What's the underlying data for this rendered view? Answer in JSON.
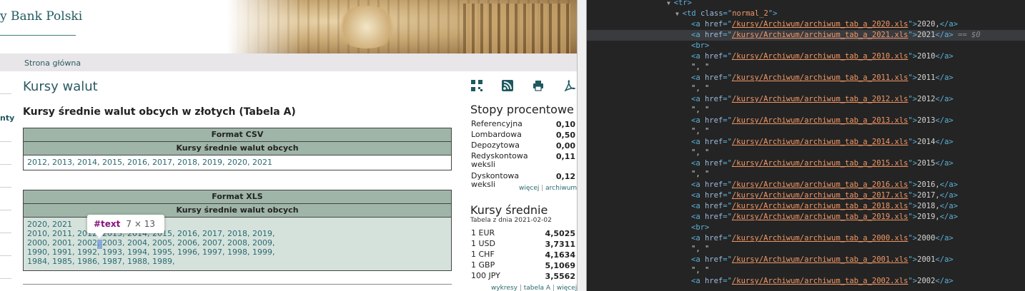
{
  "bank_title": "y Bank Polski",
  "nav": {
    "home": "Strona główna"
  },
  "sidebar_label": "nty",
  "page_heading": "Kursy walut",
  "section_title": "Kursy średnie walut obcych w złotych (Tabela A)",
  "csv_table": {
    "format": "Format CSV",
    "subheader": "Kursy średnie walut obcych",
    "years": [
      "2012",
      "2013",
      "2014",
      "2015",
      "2016",
      "2017",
      "2018",
      "2019",
      "2020",
      "2021"
    ]
  },
  "xls_table": {
    "format": "Format XLS",
    "subheader": "Kursy średnie walut obcych",
    "lines": [
      [
        "2020",
        "2021"
      ],
      [
        "2010",
        "2011",
        "2012",
        "2013",
        "2014",
        "2015",
        "2016",
        "2017",
        "2018",
        "2019"
      ],
      [
        "2000",
        "2001",
        "2002",
        "2003",
        "2004",
        "2005",
        "2006",
        "2007",
        "2008",
        "2009"
      ],
      [
        "1990",
        "1991",
        "1992",
        "1993",
        "1994",
        "1995",
        "1996",
        "1997",
        "1998",
        "1999"
      ],
      [
        "1984",
        "1985",
        "1986",
        "1987",
        "1988",
        "1989"
      ]
    ]
  },
  "tooltip": {
    "name": "#text",
    "size": "7 × 13"
  },
  "interest_rates": {
    "title": "Stopy procentowe",
    "rows": [
      {
        "label": "Referencyjna",
        "value": "0,10"
      },
      {
        "label": "Lombardowa",
        "value": "0,50"
      },
      {
        "label": "Depozytowa",
        "value": "0,00"
      },
      {
        "label": "Redyskontowa weksli",
        "value": "0,11"
      },
      {
        "label": "Dyskontowa weksli",
        "value": "0,12"
      }
    ],
    "link_more": "więcej",
    "link_archive": "archiwum"
  },
  "average_rates": {
    "title": "Kursy średnie",
    "date_line": "Tabela z dnia 2021-02-02",
    "rows": [
      {
        "label": "1 EUR",
        "value": "4,5025"
      },
      {
        "label": "1 USD",
        "value": "3,7311"
      },
      {
        "label": "1 CHF",
        "value": "4,1634"
      },
      {
        "label": "1 GBP",
        "value": "5,1069"
      },
      {
        "label": "100 JPY",
        "value": "3,5562"
      }
    ],
    "links": [
      "wykresy",
      "tabela A",
      "więcej"
    ]
  },
  "icons": [
    "qr-code-icon",
    "rss-icon",
    "print-icon",
    "pdf-icon"
  ],
  "devtools": {
    "open_tag": "<tr>",
    "td_tag": "td",
    "td_class_attr": "class",
    "td_class": "normal_2",
    "selected_suffix": "== $0",
    "br_tag": "<br>",
    "sep_text": "\", \"",
    "links": [
      {
        "href": "/kursy/Archiwum/archiwum_tab_a_2020.xls",
        "text": "2020,"
      },
      {
        "href": "/kursy/Archiwum/archiwum_tab_a_2021.xls",
        "text": "2021"
      },
      {
        "href": "/kursy/Archiwum/archiwum_tab_a_2010.xls",
        "text": "2010"
      },
      {
        "href": "/kursy/Archiwum/archiwum_tab_a_2011.xls",
        "text": "2011"
      },
      {
        "href": "/kursy/Archiwum/archiwum_tab_a_2012.xls",
        "text": "2012"
      },
      {
        "href": "/kursy/Archiwum/archiwum_tab_a_2013.xls",
        "text": "2013"
      },
      {
        "href": "/kursy/Archiwum/archiwum_tab_a_2014.xls",
        "text": "2014"
      },
      {
        "href": "/kursy/Archiwum/archiwum_tab_a_2015.xls",
        "text": "2015"
      },
      {
        "href": "/kursy/Archiwum/archiwum_tab_a_2016.xls",
        "text": "2016,"
      },
      {
        "href": "/kursy/Archiwum/archiwum_tab_a_2017.xls",
        "text": "2017,"
      },
      {
        "href": "/kursy/Archiwum/archiwum_tab_a_2018.xls",
        "text": "2018,"
      },
      {
        "href": "/kursy/Archiwum/archiwum_tab_a_2019.xls",
        "text": "2019,"
      },
      {
        "href": "/kursy/Archiwum/archiwum_tab_a_2000.xls",
        "text": "2000"
      },
      {
        "href": "/kursy/Archiwum/archiwum_tab_a_2001.xls",
        "text": "2001"
      },
      {
        "href": "/kursy/Archiwum/archiwum_tab_a_2002.xls",
        "text": "2002"
      }
    ]
  }
}
